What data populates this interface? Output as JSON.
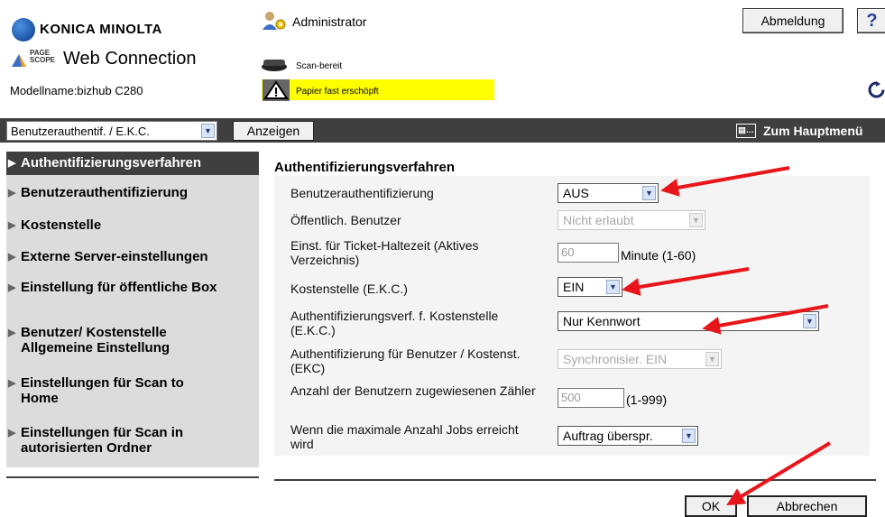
{
  "header": {
    "brand": "KONICA MINOLTA",
    "pagescope_small_top": "PAGE",
    "pagescope_small_bottom": "SCOPE",
    "product": "Web Connection",
    "model": "Modellname:bizhub C280",
    "user": "Administrator",
    "logout_label": "Abmeldung",
    "help_label": "?",
    "status_ready": "Scan-bereit",
    "status_warning": "Papier fast erschöpft"
  },
  "toolbar": {
    "category_select": "Benutzerauthentif. / E.K.C.",
    "show_label": "Anzeigen",
    "main_menu_label": "Zum Hauptmenü"
  },
  "sidebar": {
    "items": [
      {
        "label": "Authentifizierungsverfahren"
      },
      {
        "label": "Benutzerauthentifizierung"
      },
      {
        "label": "Kostenstelle"
      },
      {
        "label": "Externe Server-einstellungen"
      },
      {
        "label": "Einstellung für öffentliche Box"
      },
      {
        "label": "Benutzer/ Kostenstelle Allgemeine Einstellung"
      },
      {
        "label": "Einstellungen für Scan to Home"
      },
      {
        "label": "Einstellungen für Scan in autorisierten Ordner"
      }
    ]
  },
  "main": {
    "title": "Authentifizierungsverfahren",
    "rows": [
      {
        "label": "Benutzerauthentifizierung",
        "value": "AUS"
      },
      {
        "label": "Öffentlich. Benutzer",
        "value": "Nicht erlaubt"
      },
      {
        "label": "Einst. für Ticket-Haltezeit (Aktives Verzeichnis)",
        "value": "60",
        "suffix": "Minute (1-60)"
      },
      {
        "label": "Kostenstelle (E.K.C.)",
        "value": "EIN"
      },
      {
        "label": "Authentifizierungsverf. f. Kostenstelle (E.K.C.)",
        "value": "Nur Kennwort"
      },
      {
        "label": "Authentifizierung für Benutzer / Kostenst. (EKC)",
        "value": "Synchronisier. EIN"
      },
      {
        "label": "Anzahl der Benutzern zugewiesenen Zähler",
        "value": "500",
        "suffix": "(1-999)"
      },
      {
        "label": "Wenn die maximale Anzahl Jobs erreicht wird",
        "value": "Auftrag überspr."
      }
    ],
    "ok_label": "OK",
    "cancel_label": "Abbrechen"
  },
  "colors": {
    "dark_bar": "#3f3f3f",
    "sidebar_bg": "#dcdcdc",
    "warning_bg": "#ffff00",
    "annotation_arrow": "#e8161b"
  }
}
